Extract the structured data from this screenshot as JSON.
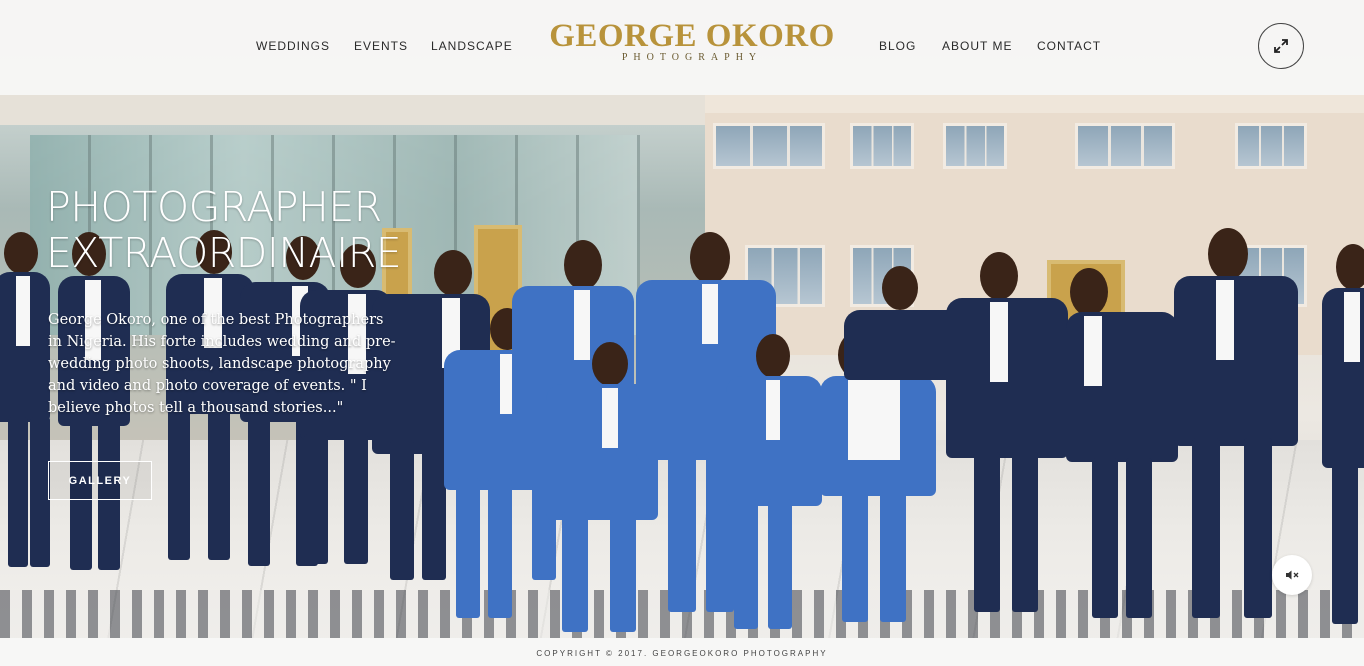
{
  "nav": {
    "left": [
      "WEDDINGS",
      "EVENTS",
      "LANDSCAPE"
    ],
    "right": [
      "BLOG",
      "ABOUT ME",
      "CONTACT"
    ]
  },
  "logo": {
    "main": "GEORGE OKORO",
    "sub": "PHOTOGRAPHY"
  },
  "hero": {
    "title": "PHOTOGRAPHER EXTRAORDINAIRE",
    "description": "George Okoro, one of the best Photographers in Nigeria. His forte includes wedding and pre-wedding photo shoots, landscape photography and video and photo coverage of events. \" I believe photos tell a thousand stories...\"",
    "button": "GALLERY"
  },
  "footer": {
    "copyright": "COPYRIGHT © 2017. GEORGEOKORO PHOTOGRAPHY"
  },
  "icons": {
    "expand": "expand-icon",
    "mute": "speaker-muted-icon"
  },
  "colors": {
    "logo_gold": "#b8933b",
    "header_bg": "#f7f7f6",
    "navy_suit": "#1f2d52",
    "royal_blue_suit": "#3f72c4"
  }
}
